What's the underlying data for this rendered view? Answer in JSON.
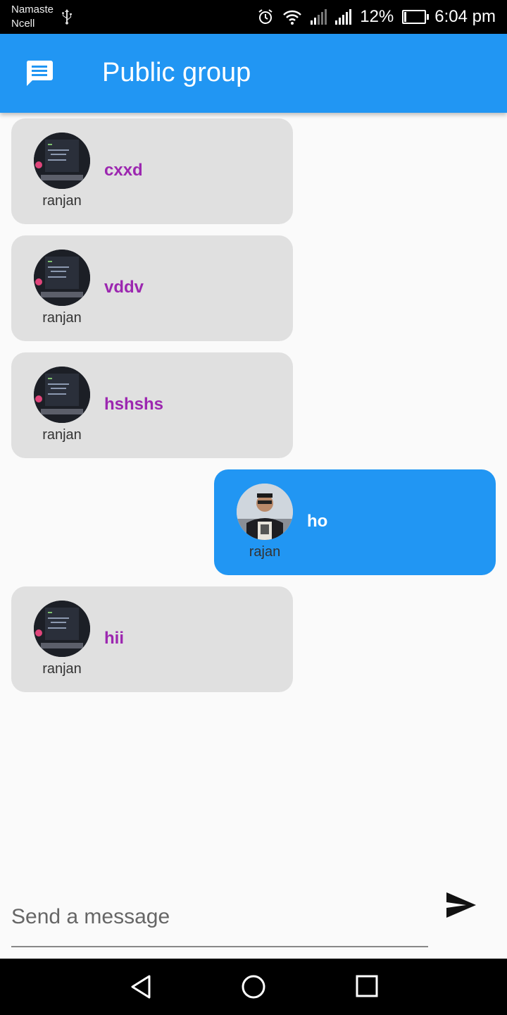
{
  "status_bar": {
    "carrier_line1": "Namaste",
    "carrier_line2": "Ncell",
    "battery_percent": "12%",
    "battery_level": 0.12,
    "time": "6:04 pm",
    "icons": [
      "usb-icon",
      "alarm-icon",
      "wifi-icon",
      "signal-icon",
      "signal-icon",
      "battery-charging-icon"
    ]
  },
  "app_bar": {
    "title": "Public group",
    "icon": "message-icon",
    "color": "#2196f3"
  },
  "messages": [
    {
      "user": "ranjan",
      "text": "cxxd",
      "side": "left"
    },
    {
      "user": "ranjan",
      "text": "vddv",
      "side": "left"
    },
    {
      "user": "ranjan",
      "text": "hshshs",
      "side": "left"
    },
    {
      "user": "rajan",
      "text": "ho",
      "side": "right"
    },
    {
      "user": "ranjan",
      "text": "hii",
      "side": "left"
    }
  ],
  "composer": {
    "placeholder": "Send a message",
    "value": "",
    "send_icon": "send-icon"
  },
  "nav_bar": {
    "icons": [
      "back-icon",
      "home-icon",
      "recents-icon"
    ]
  },
  "colors": {
    "accent": "#2196f3",
    "incoming_bubble": "#e0e0e0",
    "incoming_text": "#9c27b0",
    "outgoing_text": "#ffffff"
  }
}
